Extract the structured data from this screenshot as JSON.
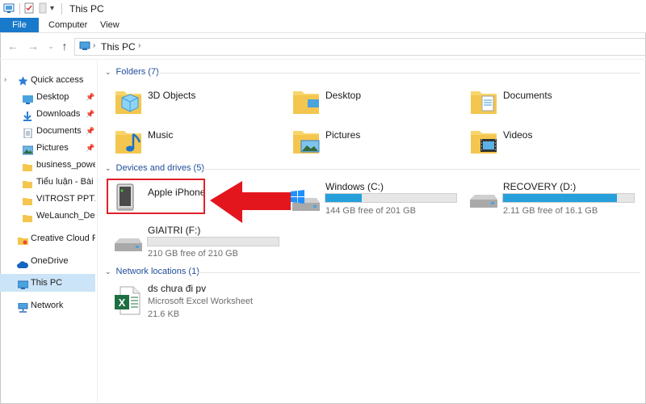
{
  "window": {
    "title": "This PC"
  },
  "ribbon": {
    "file": "File",
    "tabs": [
      "Computer",
      "View"
    ]
  },
  "address": {
    "crumbs": [
      "This PC"
    ]
  },
  "sidebar": {
    "quick_access": "Quick access",
    "items": [
      {
        "label": "Desktop",
        "pinned": true
      },
      {
        "label": "Downloads",
        "pinned": true
      },
      {
        "label": "Documents",
        "pinned": true
      },
      {
        "label": "Pictures",
        "pinned": true
      },
      {
        "label": "business_power"
      },
      {
        "label": "Tiểu luận - Bài thi"
      },
      {
        "label": "VITROST PPTX"
      },
      {
        "label": "WeLaunch_Desig"
      }
    ],
    "creative_cloud": "Creative Cloud File",
    "onedrive": "OneDrive",
    "this_pc": "This PC",
    "network": "Network"
  },
  "folders": {
    "header": "Folders (7)",
    "items": [
      "3D Objects",
      "Desktop",
      "Documents",
      "Music",
      "Pictures",
      "Videos"
    ]
  },
  "devices": {
    "header": "Devices and drives (5)",
    "iphone": "Apple iPhone",
    "drives": [
      {
        "name": "Windows (C:)",
        "free": "144 GB free of 201 GB",
        "used_fraction": 0.28
      },
      {
        "name": "RECOVERY (D:)",
        "free": "2.11 GB free of 16.1 GB",
        "used_fraction": 0.87
      },
      {
        "name": "GIAITRI (F:)",
        "free": "210 GB free of 210 GB",
        "used_fraction": 0.0
      }
    ]
  },
  "network": {
    "header": "Network locations (1)",
    "item": {
      "name": "ds chưa đi pv",
      "type": "Microsoft Excel Worksheet",
      "size": "21.6 KB"
    }
  },
  "colors": {
    "accent": "#1979ca",
    "highlight": "#e1202a",
    "bar_fill": "#26a0da",
    "excel": "#1d6f42"
  }
}
